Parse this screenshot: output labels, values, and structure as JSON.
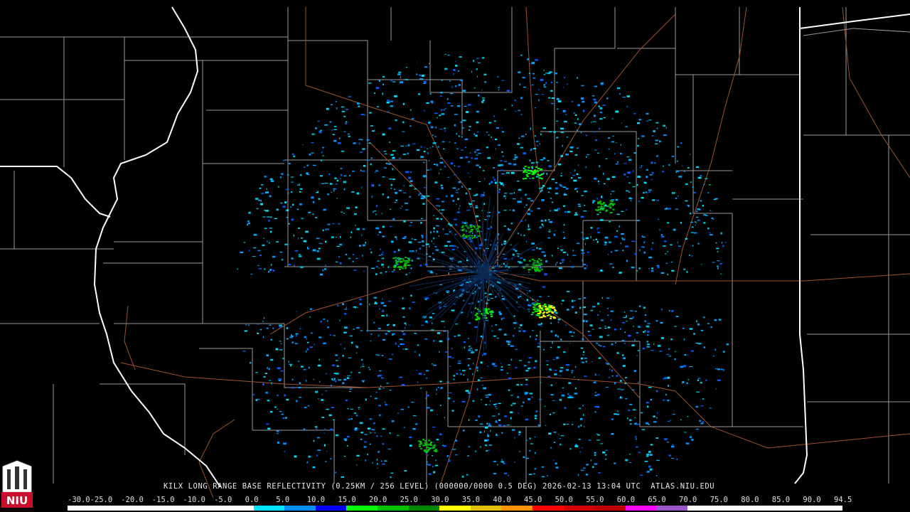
{
  "title": "KILX LONG RANGE BASE REFLECTIVITY (0.25KM / 256 LEVEL) (000000/0000 0.5 DEG) 2026-02-13 13:04 UTC  ATLAS.NIU.EDU",
  "logo": {
    "text": "NIU",
    "color": "#c8102e"
  },
  "scale_labels": [
    "-30.0",
    "-25.0",
    "-20.0",
    "-15.0",
    "-10.0",
    "-5.0",
    "0.0",
    "5.0",
    "10.0",
    "15.0",
    "20.0",
    "25.0",
    "30.0",
    "35.0",
    "40.0",
    "45.0",
    "50.0",
    "55.0",
    "60.0",
    "65.0",
    "70.0",
    "75.0",
    "80.0",
    "85.0",
    "90.0",
    "94.5"
  ],
  "scale_colors": [
    "#ffffff",
    "#ffffff",
    "#ffffff",
    "#ffffff",
    "#ffffff",
    "#ffffff",
    "#00e0ff",
    "#0090ff",
    "#0000ff",
    "#00ff00",
    "#00c000",
    "#008800",
    "#ffff00",
    "#e0c000",
    "#ff9000",
    "#ff0000",
    "#d40000",
    "#c00000",
    "#ff00ff",
    "#9955cc",
    "#ffffff",
    "#ffffff",
    "#ffffff",
    "#ffffff",
    "#ffffff"
  ]
}
